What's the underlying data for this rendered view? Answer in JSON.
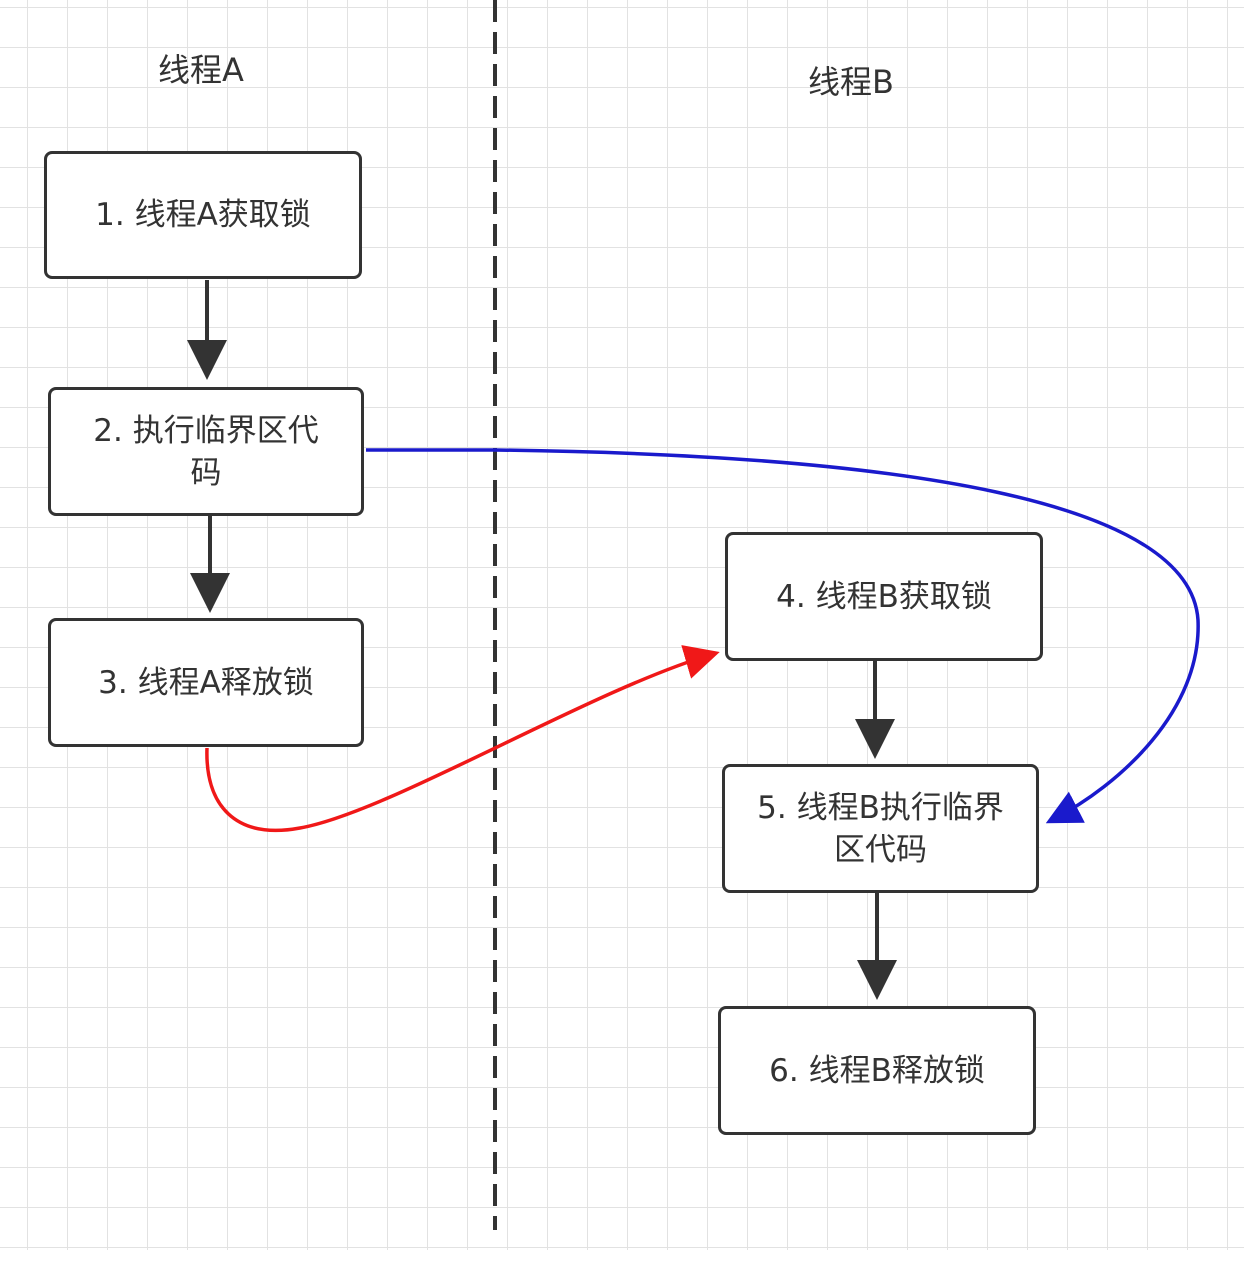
{
  "lanes": {
    "a": "线程A",
    "b": "线程B"
  },
  "steps": [
    "1. 线程A获取锁",
    "2. 执行临界区代码",
    "3. 线程A释放锁",
    "4. 线程B获取锁",
    "5. 线程B执行临界区代码",
    "6. 线程B释放锁"
  ],
  "colors": {
    "blue_arrow": "#1a1acc",
    "red_arrow": "#f01818",
    "box_border": "#333333"
  }
}
